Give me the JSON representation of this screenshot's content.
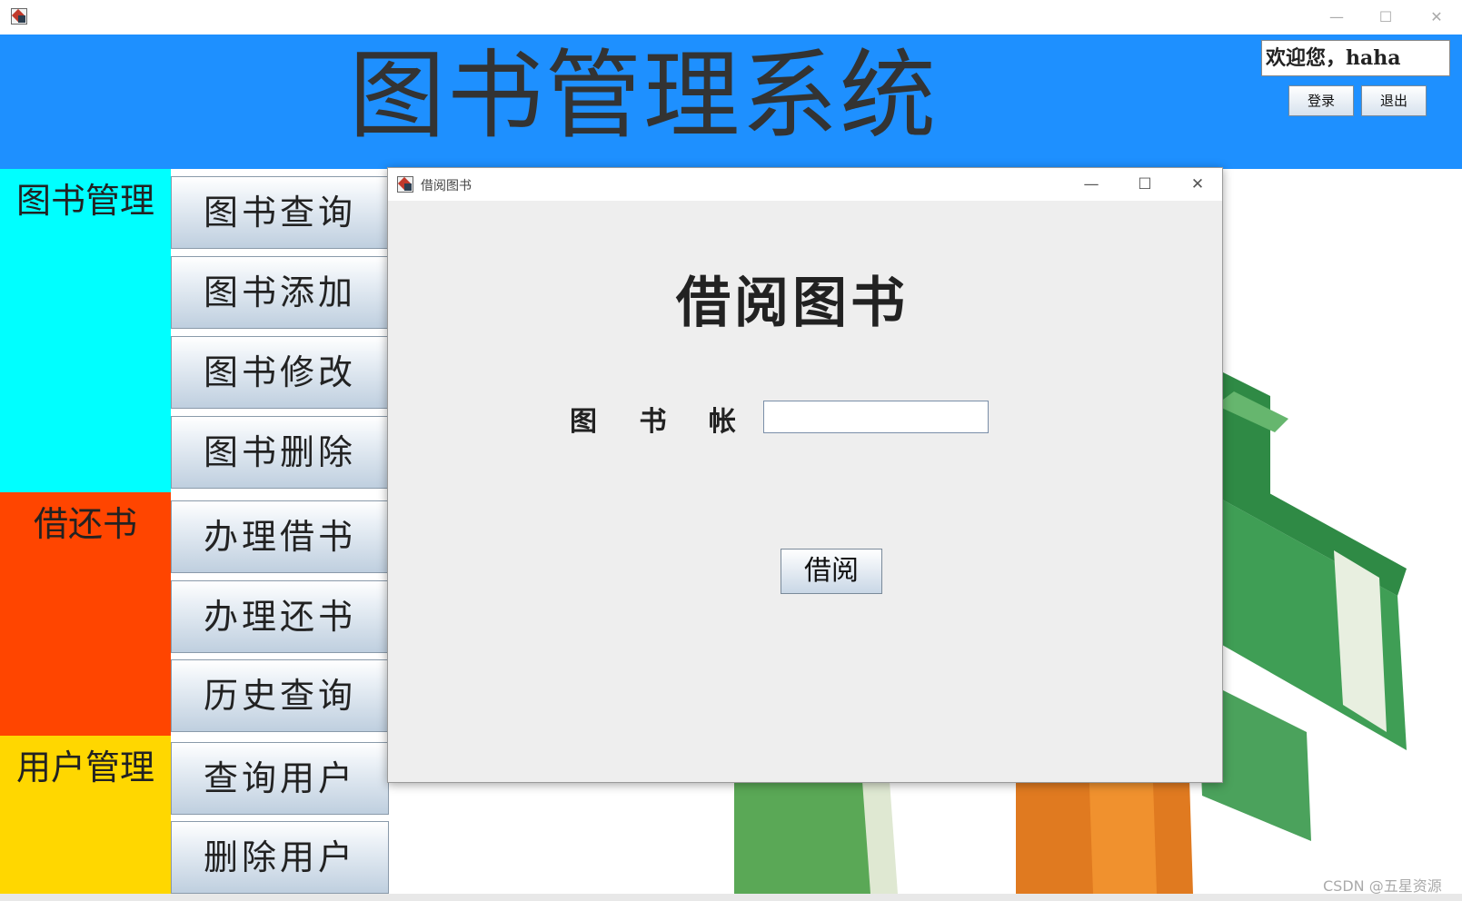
{
  "main_window": {
    "title": "",
    "controls": {
      "minimize": "—",
      "maximize": "☐",
      "close": "✕"
    }
  },
  "header": {
    "title": "图书管理系统",
    "welcome_text": "欢迎您，haha",
    "login_label": "登录",
    "logout_label": "退出",
    "bg_color": "#1e90ff"
  },
  "sidebar": {
    "sections": [
      {
        "label": "图书管理",
        "color": "#00ffff",
        "items": [
          "图书查询",
          "图书添加",
          "图书修改",
          "图书删除"
        ]
      },
      {
        "label": "借还书",
        "color": "#ff4500",
        "items": [
          "办理借书",
          "办理还书",
          "历史查询"
        ]
      },
      {
        "label": "用户管理",
        "color": "#ffd700",
        "items": [
          "查询用户",
          "删除用户"
        ]
      }
    ]
  },
  "dialog": {
    "title": "借阅图书",
    "heading": "借阅图书",
    "field_label": "图 书 帐 号",
    "field_value": "",
    "submit_label": "借阅",
    "controls": {
      "minimize": "—",
      "maximize": "☐",
      "close": "✕"
    }
  },
  "watermark": "CSDN @五星资源"
}
